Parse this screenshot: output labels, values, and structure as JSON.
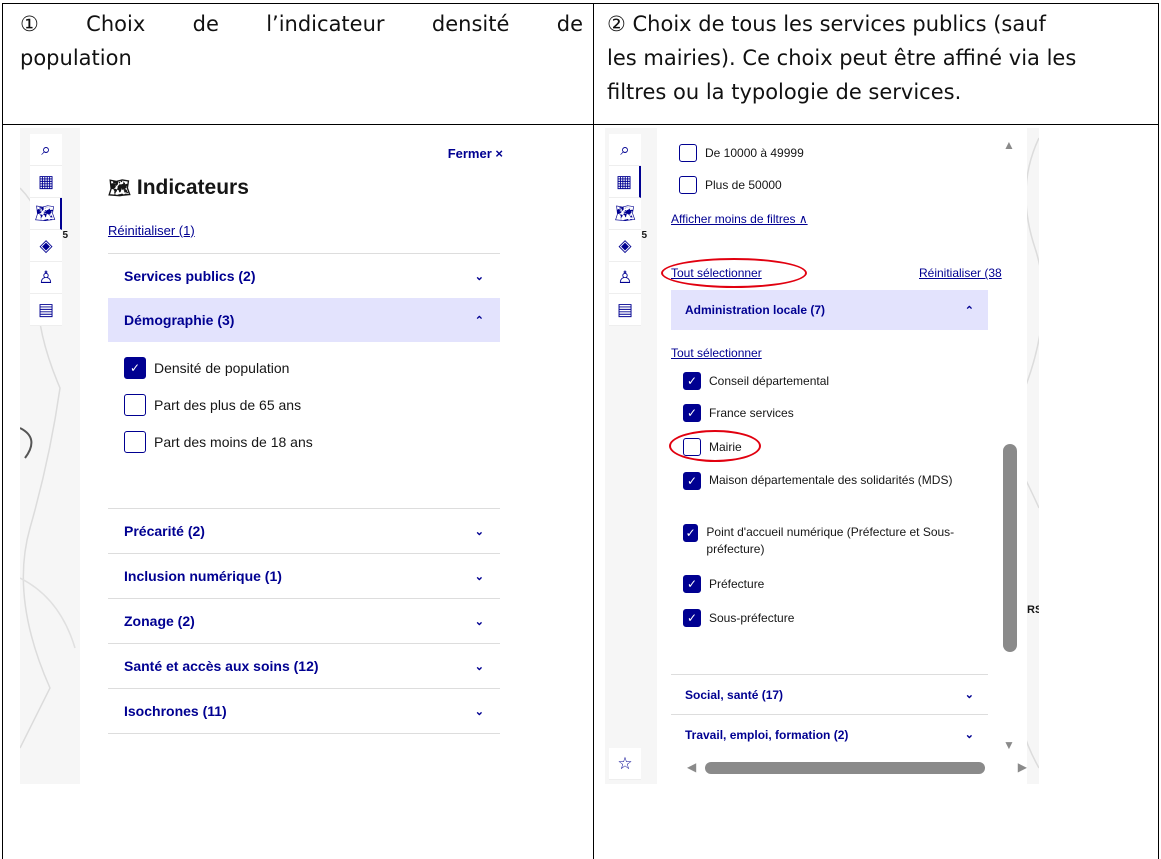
{
  "cell1": {
    "title_line1_words": [
      "①",
      "Choix",
      "de",
      "l’indicateur",
      "densité",
      "de"
    ],
    "title_line2": "population"
  },
  "cell2": {
    "title_lines": [
      "② Choix de tous les services publics (sauf",
      "les mairies). Ce choix peut être affiné via les",
      "filtres ou la typologie de services."
    ]
  },
  "shot1": {
    "toolbar": {
      "icons": [
        "search-icon",
        "building-icon",
        "map-icon",
        "layers-icon",
        "location-person-icon",
        "document-icon"
      ],
      "layers_badge": "5"
    },
    "panel": {
      "close_label": "Fermer ×",
      "title": "Indicateurs",
      "reset_label": "Réinitialiser (1)",
      "sections": [
        {
          "label": "Services publics (2)",
          "open": false
        },
        {
          "label": "Démographie (3)",
          "open": true
        },
        {
          "label": "Précarité (2)",
          "open": false
        },
        {
          "label": "Inclusion numérique (1)",
          "open": false
        },
        {
          "label": "Zonage (2)",
          "open": false
        },
        {
          "label": "Santé et accès aux soins (12)",
          "open": false
        },
        {
          "label": "Isochrones (11)",
          "open": false
        }
      ],
      "demographie_items": [
        {
          "label": "Densité de population",
          "checked": true
        },
        {
          "label": "Part des plus de 65 ans",
          "checked": false
        },
        {
          "label": "Part des moins de 18 ans",
          "checked": false
        }
      ]
    }
  },
  "shot2": {
    "toolbar": {
      "icons": [
        "search-icon",
        "building-icon",
        "map-icon",
        "layers-icon",
        "location-person-icon",
        "document-icon"
      ],
      "layers_badge": "5",
      "bottom_icon": "france-icon"
    },
    "filters": [
      {
        "label": "De 10000 à 49999",
        "checked": false
      },
      {
        "label": "Plus de 50000",
        "checked": false
      }
    ],
    "less_filters_label": "Afficher moins de filtres ∧",
    "select_all_label": "Tout sélectionner",
    "reset_label": "Réinitialiser (38",
    "admin_section": "Administration locale (7)",
    "admin_select_all": "Tout sélectionner",
    "admin_items": [
      {
        "label": "Conseil départemental",
        "checked": true
      },
      {
        "label": "France services",
        "checked": true
      },
      {
        "label": "Mairie",
        "checked": false
      },
      {
        "label": "Maison départementale des solidarités (MDS)",
        "checked": true
      },
      {
        "label": "Point d'accueil numérique (Préfecture et Sous-préfecture)",
        "checked": true
      },
      {
        "label": "Préfecture",
        "checked": true
      },
      {
        "label": "Sous-préfecture",
        "checked": true
      }
    ],
    "other_sections": [
      "Social, santé (17)",
      "Travail, emploi, formation (2)"
    ],
    "map_label": "RS",
    "accent": "#000091",
    "highlight_color": "#e1000f"
  }
}
